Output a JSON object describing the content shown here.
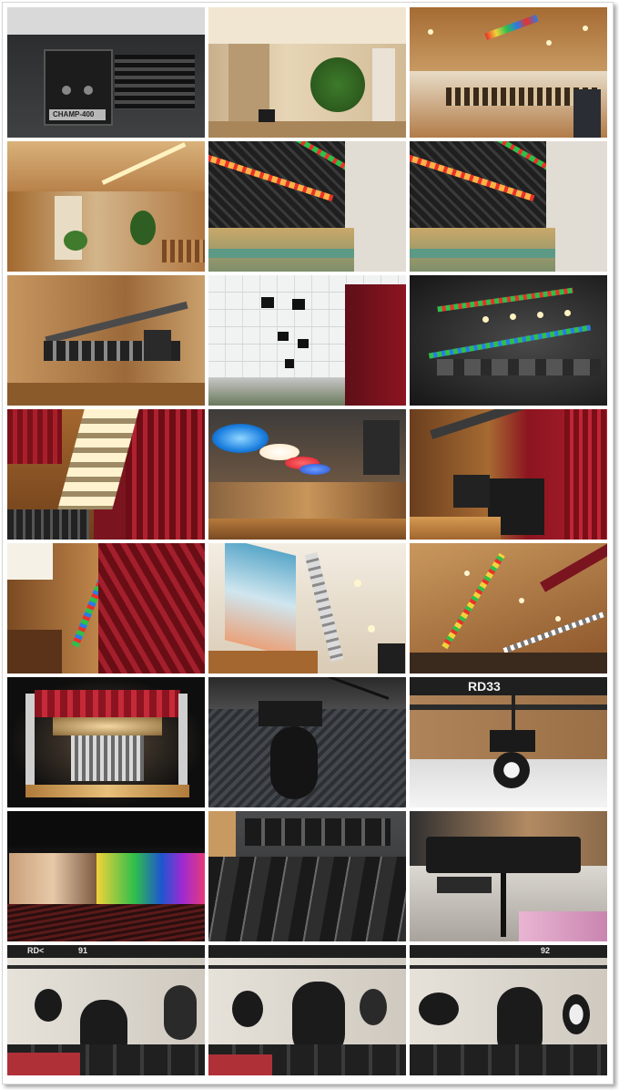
{
  "gallery": {
    "rows": 8,
    "columns": 3,
    "tiles": [
      {
        "row": 1,
        "col": 1,
        "subject": "amplifier rack unit"
      },
      {
        "row": 1,
        "col": 2,
        "subject": "lobby with podium and plant"
      },
      {
        "row": 1,
        "col": 3,
        "subject": "hall with LED fixture bar"
      },
      {
        "row": 2,
        "col": 1,
        "subject": "wood-paneled hall with podium"
      },
      {
        "row": 2,
        "col": 2,
        "subject": "gym truss with LED bars"
      },
      {
        "row": 2,
        "col": 3,
        "subject": "gym truss with LED bars"
      },
      {
        "row": 3,
        "col": 1,
        "subject": "lighting truss hanging fixtures"
      },
      {
        "row": 3,
        "col": 2,
        "subject": "ceiling spotlights and curtain"
      },
      {
        "row": 3,
        "col": 3,
        "subject": "ceiling truss with LED strips"
      },
      {
        "row": 4,
        "col": 1,
        "subject": "stage curtain and ceiling lights"
      },
      {
        "row": 4,
        "col": 2,
        "subject": "colored ceiling washes"
      },
      {
        "row": 4,
        "col": 3,
        "subject": "line array speaker and curtain"
      },
      {
        "row": 5,
        "col": 1,
        "subject": "LED bar and stage curtain"
      },
      {
        "row": 5,
        "col": 2,
        "subject": "banner and light bar"
      },
      {
        "row": 5,
        "col": 3,
        "subject": "ceiling with LED bar and curtain"
      },
      {
        "row": 6,
        "col": 1,
        "subject": "illuminated stage set"
      },
      {
        "row": 6,
        "col": 2,
        "subject": "moving head fixture close-up"
      },
      {
        "row": 6,
        "col": 3,
        "subject": "moving head with RD33 sign"
      },
      {
        "row": 7,
        "col": 1,
        "subject": "projection screen and colored wash"
      },
      {
        "row": 7,
        "col": 2,
        "subject": "rows of black fixtures"
      },
      {
        "row": 7,
        "col": 3,
        "subject": "follow spot on stand"
      },
      {
        "row": 8,
        "col": 1,
        "subject": "moving heads over banquet tables"
      },
      {
        "row": 8,
        "col": 2,
        "subject": "moving heads over banquet tables"
      },
      {
        "row": 8,
        "col": 3,
        "subject": "moving heads over banquet tables"
      }
    ]
  },
  "visible_text": {
    "amp_brand": "CHAMP-400",
    "sign_rd33": "RD33",
    "sign_rd_left": "RD<",
    "sign_91": "91",
    "sign_92": "92"
  },
  "colors": {
    "wood": "#b9824a",
    "curtain": "#8c1420",
    "ceiling_warm": "#c89a62",
    "truss_dark": "#2b2b2b",
    "led_red": "#e8322a",
    "led_green": "#2fbf4a",
    "led_blue": "#2a7be8",
    "led_yellow": "#f2d23a"
  }
}
